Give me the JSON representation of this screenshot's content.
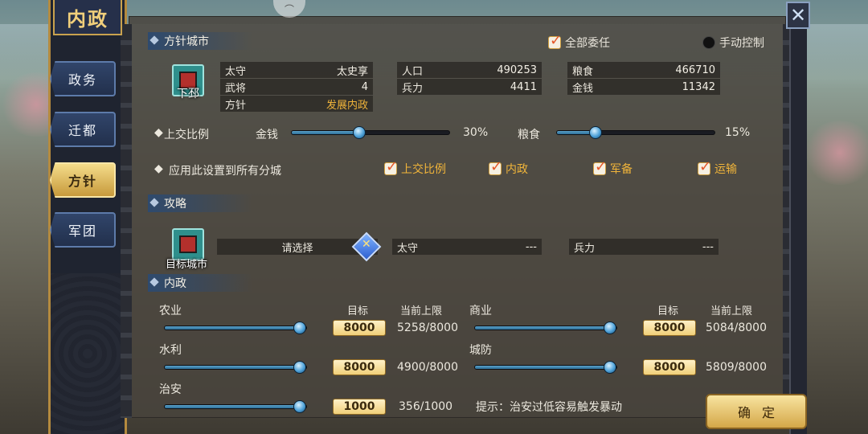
{
  "banner": {
    "title": "内政"
  },
  "nav": [
    {
      "label": "政务",
      "active": false
    },
    {
      "label": "迁都",
      "active": false
    },
    {
      "label": "方针",
      "active": true
    },
    {
      "label": "军团",
      "active": false
    }
  ],
  "policy_city": {
    "header": "方针城市",
    "delegate_all": "全部委任",
    "manual_control": "手动控制",
    "city_name": "下邳",
    "info": {
      "governor_label": "太守",
      "governor_value": "太史享",
      "generals_label": "武将",
      "generals_value": "4",
      "policy_label": "方针",
      "policy_value": "发展内政",
      "population_label": "人口",
      "population_value": "490253",
      "troops_label": "兵力",
      "troops_value": "4411",
      "food_label": "粮食",
      "food_value": "466710",
      "money_label": "金钱",
      "money_value": "11342"
    },
    "tribute": {
      "label": "上交比例",
      "money_label": "金钱",
      "money_pct": "30%",
      "money_level": 0.3,
      "food_label": "粮食",
      "food_pct": "15%",
      "food_level": 0.15
    },
    "apply_all": "应用此设置到所有分城",
    "apply_checks": [
      "上交比例",
      "内政",
      "军备",
      "运输"
    ]
  },
  "strategy": {
    "header": "攻略",
    "target_city_label": "目标城市",
    "select_prompt": "请选择",
    "governor_label": "太守",
    "governor_value": "---",
    "troops_label": "兵力",
    "troops_value": "---"
  },
  "domestic": {
    "header": "内政",
    "target_label": "目标",
    "current_limit_label": "当前上限",
    "items": [
      {
        "name": "农业",
        "target": "8000",
        "current": "5258/8000",
        "level": 1.0
      },
      {
        "name": "商业",
        "target": "8000",
        "current": "5084/8000",
        "level": 1.0
      },
      {
        "name": "水利",
        "target": "8000",
        "current": "4900/8000",
        "level": 1.0
      },
      {
        "name": "城防",
        "target": "8000",
        "current": "5809/8000",
        "level": 1.0
      },
      {
        "name": "治安",
        "target": "1000",
        "current": "356/1000",
        "level": 1.0
      }
    ],
    "hint": "提示：治安过低容易触发暴动"
  },
  "confirm": "确定",
  "close_icon": "close-x-icon"
}
